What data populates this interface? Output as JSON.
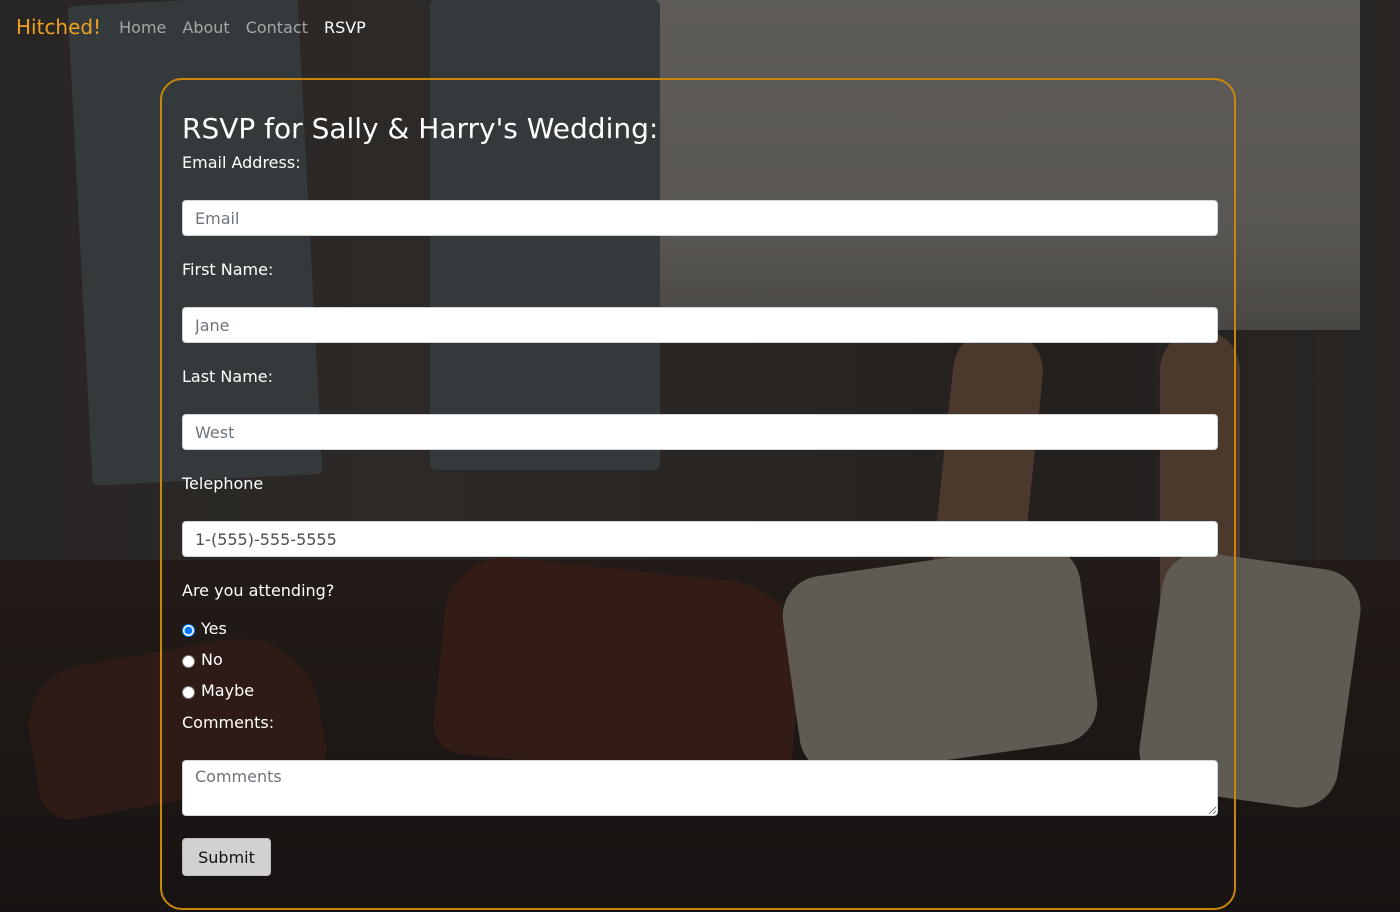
{
  "nav": {
    "brand": "Hitched!",
    "links": [
      "Home",
      "About",
      "Contact",
      "RSVP"
    ],
    "active": "RSVP"
  },
  "colors": {
    "accent": "#f0a020",
    "card_border": "#c8860d"
  },
  "form": {
    "title": "RSVP for Sally & Harry's Wedding:",
    "email": {
      "label": "Email Address:",
      "placeholder": "Email",
      "value": ""
    },
    "first_name": {
      "label": "First Name:",
      "placeholder": "Jane",
      "value": ""
    },
    "last_name": {
      "label": "Last Name:",
      "placeholder": "West",
      "value": ""
    },
    "telephone": {
      "label": "Telephone",
      "placeholder": "",
      "value": "1-(555)-555-5555"
    },
    "attending": {
      "label": "Are you attending?",
      "options": [
        "Yes",
        "No",
        "Maybe"
      ],
      "selected": "Yes"
    },
    "comments": {
      "label": "Comments:",
      "placeholder": "Comments",
      "value": ""
    },
    "submit_label": "Submit"
  }
}
